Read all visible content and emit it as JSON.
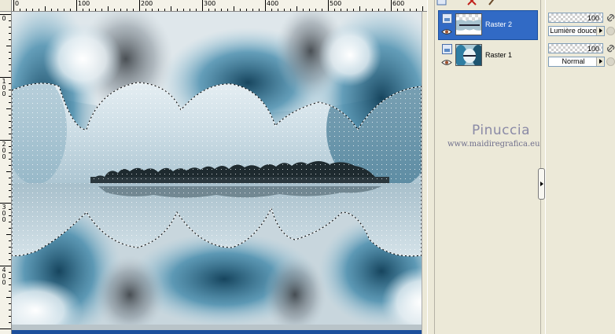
{
  "ruler": {
    "top_labels": [
      "0",
      "100",
      "200",
      "300",
      "400",
      "500",
      "600"
    ],
    "left_labels": [
      "0",
      "1\n0\n0",
      "2\n0\n0",
      "3\n0\n0",
      "4\n0\n0"
    ]
  },
  "layers": [
    {
      "name": "Raster 2",
      "selected": true,
      "opacity": "100",
      "blend_mode": "Lumière douce"
    },
    {
      "name": "Raster 1",
      "selected": false,
      "opacity": "100",
      "blend_mode": "Normal"
    }
  ],
  "watermark": {
    "name": "Pinuccia",
    "url": "www.maidiregrafica.eu"
  },
  "icons": {
    "layer_type": "raster-layer-icon",
    "visibility": "eye-icon",
    "link": "link-icon",
    "lock": "lock-icon",
    "toolbar": [
      "new-layer-icon",
      "delete-layer-icon",
      "properties-icon"
    ]
  },
  "colors": {
    "selection_highlight": "#316ac5",
    "window_bg": "#ece9d8",
    "canvas_teal": "#3a8fb0"
  }
}
